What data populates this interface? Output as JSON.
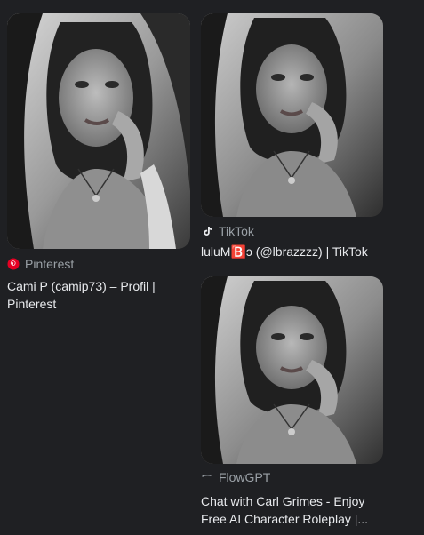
{
  "results": [
    {
      "source": "Pinterest",
      "source_icon": "pinterest-icon",
      "title": "Cami P (camip73) – Profil | Pinterest",
      "image_alt": "black and white portrait photo"
    },
    {
      "source": "TikTok",
      "source_icon": "tiktok-icon",
      "title": "luluM⁧🅱️⁩ɔ (@lbrazzzz) | TikTok",
      "image_alt": "black and white portrait photo"
    },
    {
      "source": "FlowGPT",
      "source_icon": "flowgpt-icon",
      "title": "Chat with Carl Grimes - Enjoy Free AI Character Roleplay |...",
      "image_alt": "black and white portrait photo"
    }
  ],
  "colors": {
    "background": "#1f2023",
    "title_text": "#e8eaed",
    "source_text": "#9aa0a6",
    "pinterest_red": "#e60023"
  }
}
